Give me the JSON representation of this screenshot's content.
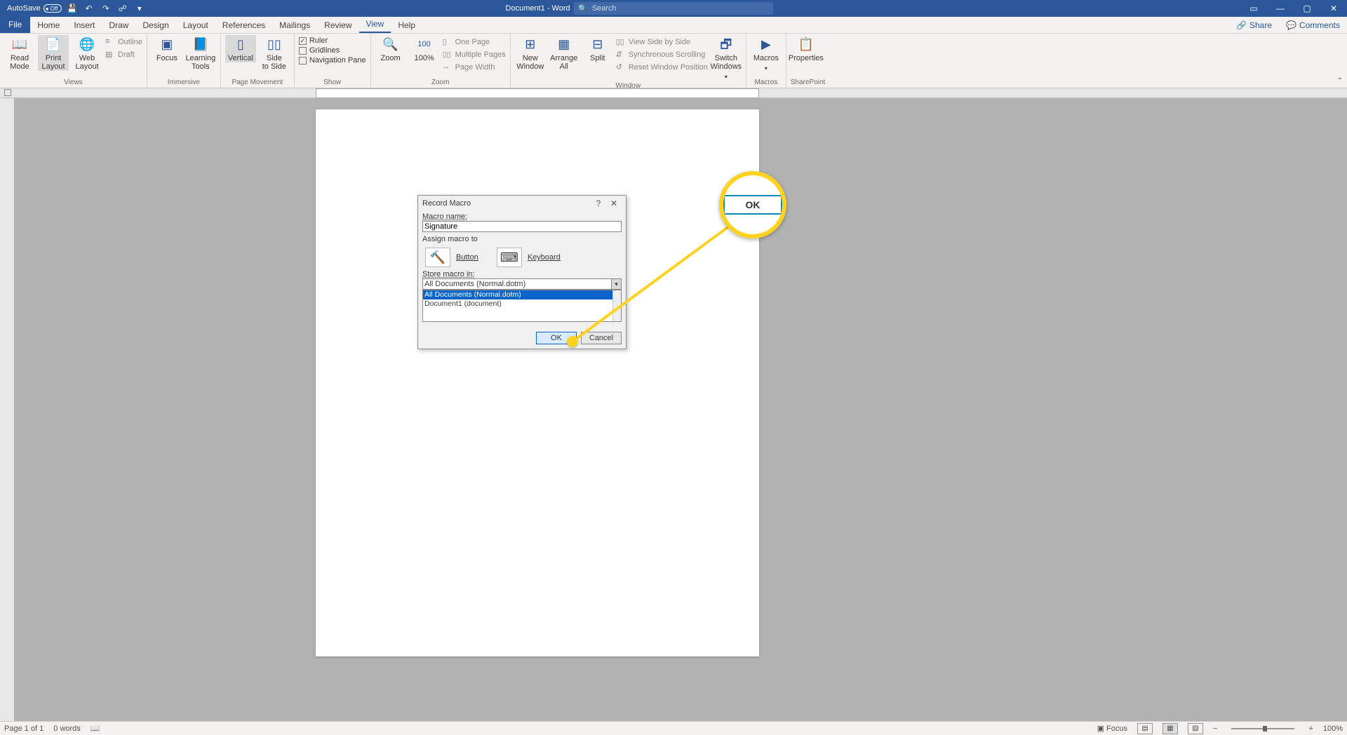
{
  "titlebar": {
    "autosave_label": "AutoSave",
    "autosave_state": "Off",
    "document_title": "Document1 - Word",
    "search_placeholder": "Search"
  },
  "tabs": {
    "file": "File",
    "items": [
      "Home",
      "Insert",
      "Draw",
      "Design",
      "Layout",
      "References",
      "Mailings",
      "Review",
      "View",
      "Help"
    ],
    "active_index": 8,
    "share": "Share",
    "comments": "Comments"
  },
  "ribbon": {
    "views": {
      "read_mode": "Read\nMode",
      "print_layout": "Print\nLayout",
      "web_layout": "Web\nLayout",
      "outline": "Outline",
      "draft": "Draft",
      "group": "Views"
    },
    "immersive": {
      "focus": "Focus",
      "learning_tools": "Learning\nTools",
      "group": "Immersive"
    },
    "page_movement": {
      "vertical": "Vertical",
      "side_to_side": "Side\nto Side",
      "group": "Page Movement"
    },
    "show": {
      "ruler": "Ruler",
      "gridlines": "Gridlines",
      "nav_pane": "Navigation Pane",
      "group": "Show"
    },
    "zoom": {
      "zoom": "Zoom",
      "hundred": "100%",
      "one_page": "One Page",
      "multiple_pages": "Multiple Pages",
      "page_width": "Page Width",
      "group": "Zoom"
    },
    "window": {
      "new_window": "New\nWindow",
      "arrange_all": "Arrange\nAll",
      "split": "Split",
      "side_by_side": "View Side by Side",
      "sync_scroll": "Synchronous Scrolling",
      "reset_pos": "Reset Window Position",
      "switch_windows": "Switch\nWindows",
      "group": "Window"
    },
    "macros": {
      "macros": "Macros",
      "group": "Macros"
    },
    "sharepoint": {
      "properties": "Properties",
      "group": "SharePoint"
    }
  },
  "dialog": {
    "title": "Record Macro",
    "macro_name_label": "Macro name:",
    "macro_name_value": "Signature",
    "assign_label": "Assign macro to",
    "button": "Button",
    "keyboard": "Keyboard",
    "store_label": "Store macro in:",
    "store_value": "All Documents (Normal.dotm)",
    "list": [
      "All Documents (Normal.dotm)",
      "Document1 (document)"
    ],
    "list_selected": 0,
    "ok": "OK",
    "cancel": "Cancel"
  },
  "callout": {
    "ok": "OK"
  },
  "statusbar": {
    "page": "Page 1 of 1",
    "words": "0 words",
    "focus": "Focus",
    "zoom": "100%"
  }
}
